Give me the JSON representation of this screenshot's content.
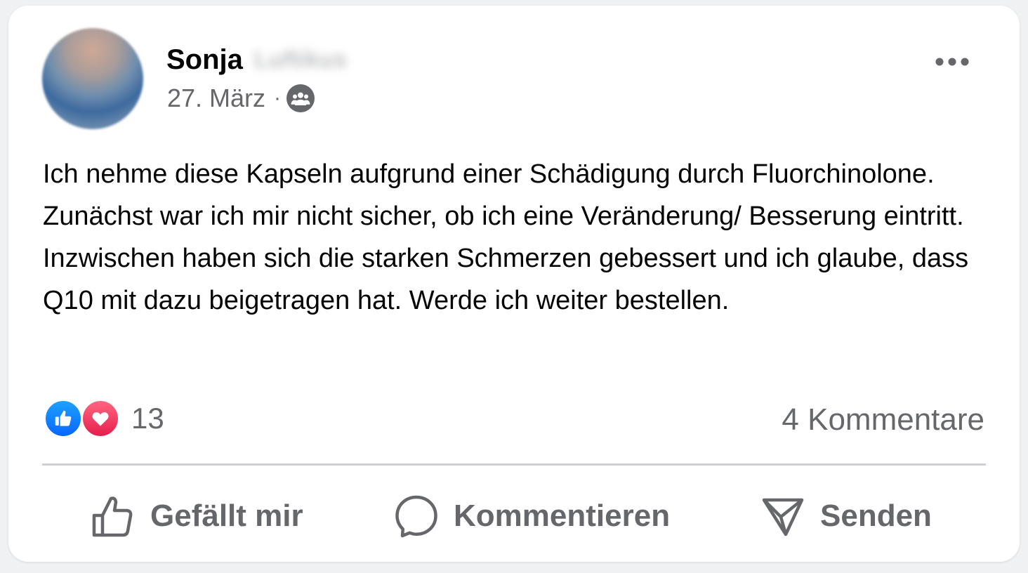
{
  "post": {
    "author": {
      "first_name": "Sonja",
      "last_name": "Luftikus"
    },
    "date": "27. März",
    "separator": "·",
    "audience_icon": "group-icon",
    "more_icon": "more-options-icon",
    "text": "Ich nehme diese Kapseln aufgrund einer Schädigung durch Fluorchinolone. Zunächst war ich mir nicht sicher, ob ich eine Veränderung/ Besserung eintritt. Inzwischen haben sich die starken Schmerzen gebessert und ich glaube, dass Q10 mit dazu beigetragen hat. Werde ich weiter bestellen."
  },
  "stats": {
    "reactions": [
      "like-reaction-icon",
      "love-reaction-icon"
    ],
    "reaction_count": "13",
    "comments": "4 Kommentare"
  },
  "actions": {
    "like": {
      "label": "Gefällt mir",
      "icon": "thumbs-up-icon"
    },
    "comment": {
      "label": "Kommentieren",
      "icon": "comment-bubble-icon"
    },
    "share": {
      "label": "Senden",
      "icon": "send-icon"
    }
  },
  "colors": {
    "text": "#050505",
    "secondary": "#65676b",
    "like_blue": "#0866ff",
    "love_red": "#f33e58",
    "divider": "#ced0d4"
  }
}
